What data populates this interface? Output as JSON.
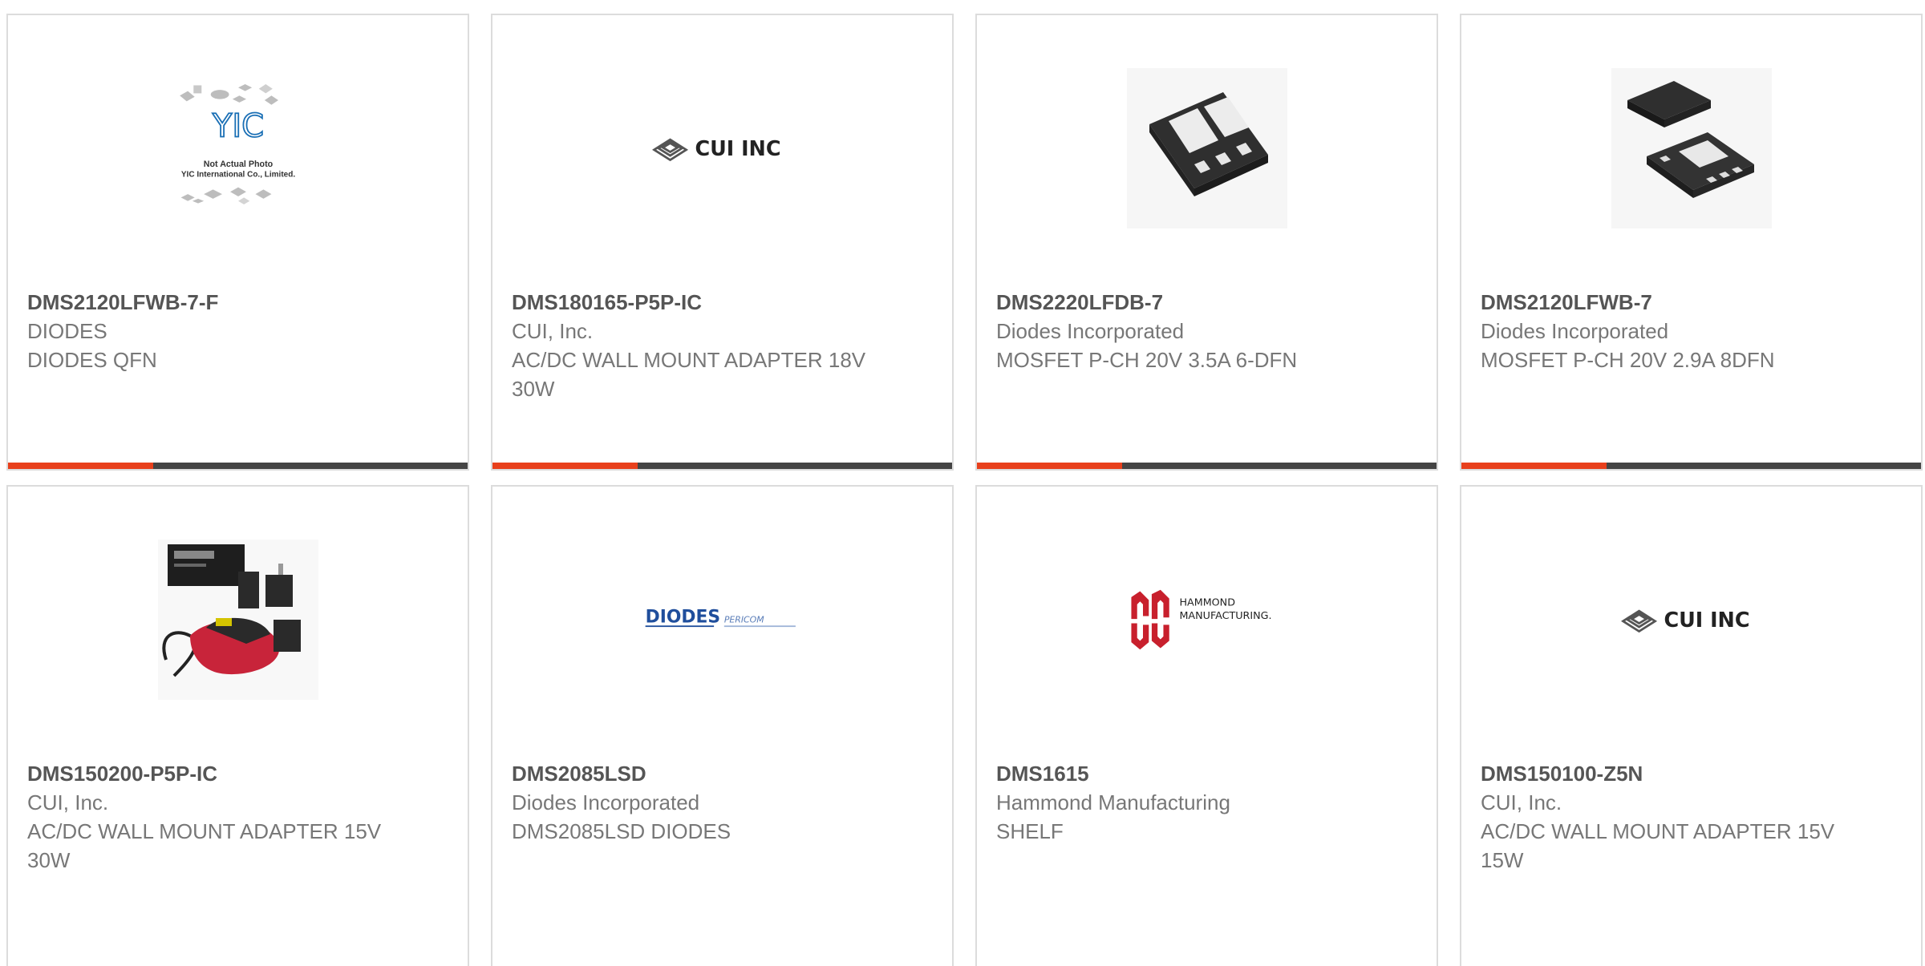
{
  "products": [
    {
      "part": "DMS2120LFWB-7-F",
      "manufacturer": "DIODES",
      "description": "DIODES QFN",
      "image": "not-actual-photo-icon",
      "image_text": [
        "Not Actual Photo",
        "YIC International Co., Limited."
      ],
      "logo": "YIC"
    },
    {
      "part": "DMS180165-P5P-IC",
      "manufacturer": "CUI, Inc.",
      "description": "AC/DC WALL MOUNT ADAPTER 18V 30W",
      "image": "cui-inc-logo",
      "logo": "CUI INC"
    },
    {
      "part": "DMS2220LFDB-7",
      "manufacturer": "Diodes Incorporated",
      "description": "MOSFET P-CH 20V 3.5A 6-DFN",
      "image": "dfn-chip-icon"
    },
    {
      "part": "DMS2120LFWB-7",
      "manufacturer": "Diodes Incorporated",
      "description": "MOSFET P-CH 20V 2.9A 8DFN",
      "image": "dfn-chip-pair-icon"
    },
    {
      "part": "DMS150200-P5P-IC",
      "manufacturer": "CUI, Inc.",
      "description": "AC/DC WALL MOUNT ADAPTER 15V 30W",
      "image": "wall-adapter-photo-icon"
    },
    {
      "part": "DMS2085LSD",
      "manufacturer": "Diodes Incorporated",
      "description": "DMS2085LSD DIODES",
      "image": "diodes-pericom-logo",
      "logo": "DIODES",
      "logo2": "PERICOM"
    },
    {
      "part": "DMS1615",
      "manufacturer": "Hammond Manufacturing",
      "description": "SHELF",
      "image": "hammond-logo",
      "logo": "HAMMOND",
      "logo2": "MANUFACTURING."
    },
    {
      "part": "DMS150100-Z5N",
      "manufacturer": "CUI, Inc.",
      "description": "AC/DC WALL MOUNT ADAPTER 15V 15W",
      "image": "cui-inc-logo",
      "logo": "CUI INC"
    }
  ],
  "colors": {
    "accent": "#e8401c",
    "bar": "#444444",
    "border": "#dcdcdc",
    "part_text": "#555555",
    "meta_text": "#777777"
  }
}
